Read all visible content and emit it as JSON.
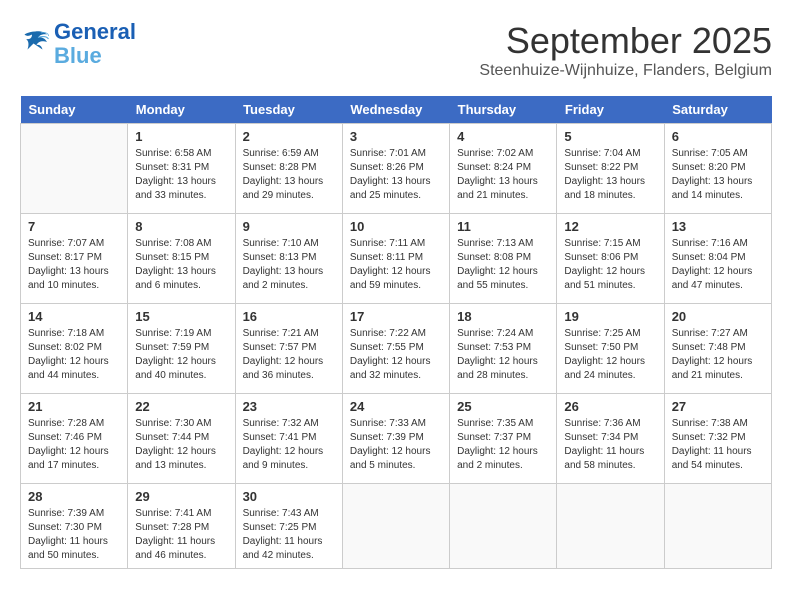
{
  "header": {
    "logo_line1": "General",
    "logo_line2": "Blue",
    "month": "September 2025",
    "location": "Steenhuize-Wijnhuize, Flanders, Belgium"
  },
  "days_of_week": [
    "Sunday",
    "Monday",
    "Tuesday",
    "Wednesday",
    "Thursday",
    "Friday",
    "Saturday"
  ],
  "weeks": [
    [
      {
        "day": "",
        "info": ""
      },
      {
        "day": "1",
        "info": "Sunrise: 6:58 AM\nSunset: 8:31 PM\nDaylight: 13 hours\nand 33 minutes."
      },
      {
        "day": "2",
        "info": "Sunrise: 6:59 AM\nSunset: 8:28 PM\nDaylight: 13 hours\nand 29 minutes."
      },
      {
        "day": "3",
        "info": "Sunrise: 7:01 AM\nSunset: 8:26 PM\nDaylight: 13 hours\nand 25 minutes."
      },
      {
        "day": "4",
        "info": "Sunrise: 7:02 AM\nSunset: 8:24 PM\nDaylight: 13 hours\nand 21 minutes."
      },
      {
        "day": "5",
        "info": "Sunrise: 7:04 AM\nSunset: 8:22 PM\nDaylight: 13 hours\nand 18 minutes."
      },
      {
        "day": "6",
        "info": "Sunrise: 7:05 AM\nSunset: 8:20 PM\nDaylight: 13 hours\nand 14 minutes."
      }
    ],
    [
      {
        "day": "7",
        "info": "Sunrise: 7:07 AM\nSunset: 8:17 PM\nDaylight: 13 hours\nand 10 minutes."
      },
      {
        "day": "8",
        "info": "Sunrise: 7:08 AM\nSunset: 8:15 PM\nDaylight: 13 hours\nand 6 minutes."
      },
      {
        "day": "9",
        "info": "Sunrise: 7:10 AM\nSunset: 8:13 PM\nDaylight: 13 hours\nand 2 minutes."
      },
      {
        "day": "10",
        "info": "Sunrise: 7:11 AM\nSunset: 8:11 PM\nDaylight: 12 hours\nand 59 minutes."
      },
      {
        "day": "11",
        "info": "Sunrise: 7:13 AM\nSunset: 8:08 PM\nDaylight: 12 hours\nand 55 minutes."
      },
      {
        "day": "12",
        "info": "Sunrise: 7:15 AM\nSunset: 8:06 PM\nDaylight: 12 hours\nand 51 minutes."
      },
      {
        "day": "13",
        "info": "Sunrise: 7:16 AM\nSunset: 8:04 PM\nDaylight: 12 hours\nand 47 minutes."
      }
    ],
    [
      {
        "day": "14",
        "info": "Sunrise: 7:18 AM\nSunset: 8:02 PM\nDaylight: 12 hours\nand 44 minutes."
      },
      {
        "day": "15",
        "info": "Sunrise: 7:19 AM\nSunset: 7:59 PM\nDaylight: 12 hours\nand 40 minutes."
      },
      {
        "day": "16",
        "info": "Sunrise: 7:21 AM\nSunset: 7:57 PM\nDaylight: 12 hours\nand 36 minutes."
      },
      {
        "day": "17",
        "info": "Sunrise: 7:22 AM\nSunset: 7:55 PM\nDaylight: 12 hours\nand 32 minutes."
      },
      {
        "day": "18",
        "info": "Sunrise: 7:24 AM\nSunset: 7:53 PM\nDaylight: 12 hours\nand 28 minutes."
      },
      {
        "day": "19",
        "info": "Sunrise: 7:25 AM\nSunset: 7:50 PM\nDaylight: 12 hours\nand 24 minutes."
      },
      {
        "day": "20",
        "info": "Sunrise: 7:27 AM\nSunset: 7:48 PM\nDaylight: 12 hours\nand 21 minutes."
      }
    ],
    [
      {
        "day": "21",
        "info": "Sunrise: 7:28 AM\nSunset: 7:46 PM\nDaylight: 12 hours\nand 17 minutes."
      },
      {
        "day": "22",
        "info": "Sunrise: 7:30 AM\nSunset: 7:44 PM\nDaylight: 12 hours\nand 13 minutes."
      },
      {
        "day": "23",
        "info": "Sunrise: 7:32 AM\nSunset: 7:41 PM\nDaylight: 12 hours\nand 9 minutes."
      },
      {
        "day": "24",
        "info": "Sunrise: 7:33 AM\nSunset: 7:39 PM\nDaylight: 12 hours\nand 5 minutes."
      },
      {
        "day": "25",
        "info": "Sunrise: 7:35 AM\nSunset: 7:37 PM\nDaylight: 12 hours\nand 2 minutes."
      },
      {
        "day": "26",
        "info": "Sunrise: 7:36 AM\nSunset: 7:34 PM\nDaylight: 11 hours\nand 58 minutes."
      },
      {
        "day": "27",
        "info": "Sunrise: 7:38 AM\nSunset: 7:32 PM\nDaylight: 11 hours\nand 54 minutes."
      }
    ],
    [
      {
        "day": "28",
        "info": "Sunrise: 7:39 AM\nSunset: 7:30 PM\nDaylight: 11 hours\nand 50 minutes."
      },
      {
        "day": "29",
        "info": "Sunrise: 7:41 AM\nSunset: 7:28 PM\nDaylight: 11 hours\nand 46 minutes."
      },
      {
        "day": "30",
        "info": "Sunrise: 7:43 AM\nSunset: 7:25 PM\nDaylight: 11 hours\nand 42 minutes."
      },
      {
        "day": "",
        "info": ""
      },
      {
        "day": "",
        "info": ""
      },
      {
        "day": "",
        "info": ""
      },
      {
        "day": "",
        "info": ""
      }
    ]
  ]
}
